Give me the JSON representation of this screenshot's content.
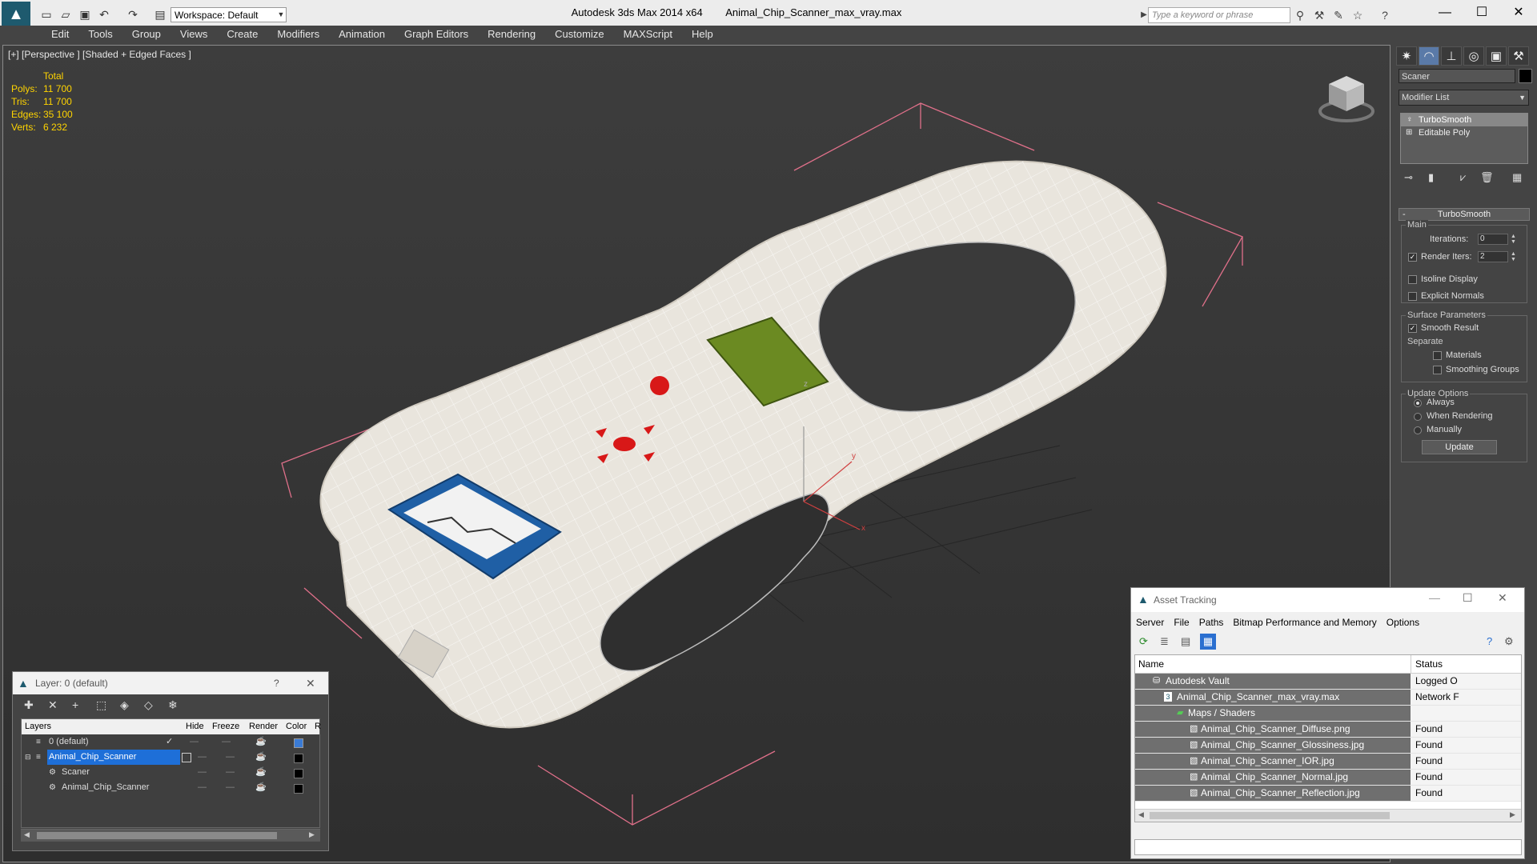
{
  "titlebar": {
    "app_title": "Autodesk 3ds Max  2014 x64",
    "file_name": "Animal_Chip_Scanner_max_vray.max",
    "workspace": "Workspace: Default",
    "search_placeholder": "Type a keyword or phrase"
  },
  "menu": [
    "Edit",
    "Tools",
    "Group",
    "Views",
    "Create",
    "Modifiers",
    "Animation",
    "Graph Editors",
    "Rendering",
    "Customize",
    "MAXScript",
    "Help"
  ],
  "viewport": {
    "label": "[+] [Perspective ] [Shaded + Edged Faces ]",
    "stats": {
      "header": "Total",
      "rows": [
        {
          "label": "Polys:",
          "value": "11 700"
        },
        {
          "label": "Tris:",
          "value": "11 700"
        },
        {
          "label": "Edges:",
          "value": "35 100"
        },
        {
          "label": "Verts:",
          "value": "6 232"
        }
      ]
    },
    "axis": {
      "x": "x",
      "y": "y",
      "z": "z"
    }
  },
  "command_panel": {
    "object_name": "Scaner",
    "modifier_list": "Modifier List",
    "stack": [
      "TurboSmooth",
      "Editable Poly"
    ],
    "rollout": "TurboSmooth",
    "main_group": "Main",
    "iterations_label": "Iterations:",
    "iterations": "0",
    "render_iters_label": "Render Iters:",
    "render_iters": "2",
    "isoline": "Isoline Display",
    "explicit_normals": "Explicit Normals",
    "surface_group": "Surface Parameters",
    "smooth_result": "Smooth Result",
    "separate": "Separate",
    "materials": "Materials",
    "smoothing_groups": "Smoothing Groups",
    "update_group": "Update Options",
    "always": "Always",
    "when_rendering": "When Rendering",
    "manually": "Manually",
    "update_btn": "Update"
  },
  "layer_dialog": {
    "title": "Layer: 0 (default)",
    "help": "?",
    "columns": [
      "Layers",
      "Hide",
      "Freeze",
      "Render",
      "Color",
      "R"
    ],
    "rows": [
      {
        "name": "0 (default)",
        "color": "#3a7bd5"
      },
      {
        "name": "Animal_Chip_Scanner",
        "color": "#000000"
      },
      {
        "name": "Scaner",
        "color": "#000000"
      },
      {
        "name": "Animal_Chip_Scanner",
        "color": "#000000"
      }
    ]
  },
  "asset_dialog": {
    "title": "Asset Tracking",
    "menu": [
      "Server",
      "File",
      "Paths",
      "Bitmap Performance and Memory",
      "Options"
    ],
    "col_name": "Name",
    "col_status": "Status",
    "rows": [
      {
        "name": "Autodesk Vault",
        "status": "Logged O"
      },
      {
        "name": "Animal_Chip_Scanner_max_vray.max",
        "status": "Network F"
      },
      {
        "name": "Maps / Shaders",
        "status": ""
      },
      {
        "name": "Animal_Chip_Scanner_Diffuse.png",
        "status": "Found"
      },
      {
        "name": "Animal_Chip_Scanner_Glossiness.jpg",
        "status": "Found"
      },
      {
        "name": "Animal_Chip_Scanner_IOR.jpg",
        "status": "Found"
      },
      {
        "name": "Animal_Chip_Scanner_Normal.jpg",
        "status": "Found"
      },
      {
        "name": "Animal_Chip_Scanner_Reflection.jpg",
        "status": "Found"
      }
    ]
  },
  "colors": {
    "selection": "#1e6fd8",
    "stats_text": "#ffd400",
    "screen_green": "#6b8a22",
    "button_red": "#d81818",
    "label_blue": "#1f5fa5"
  }
}
